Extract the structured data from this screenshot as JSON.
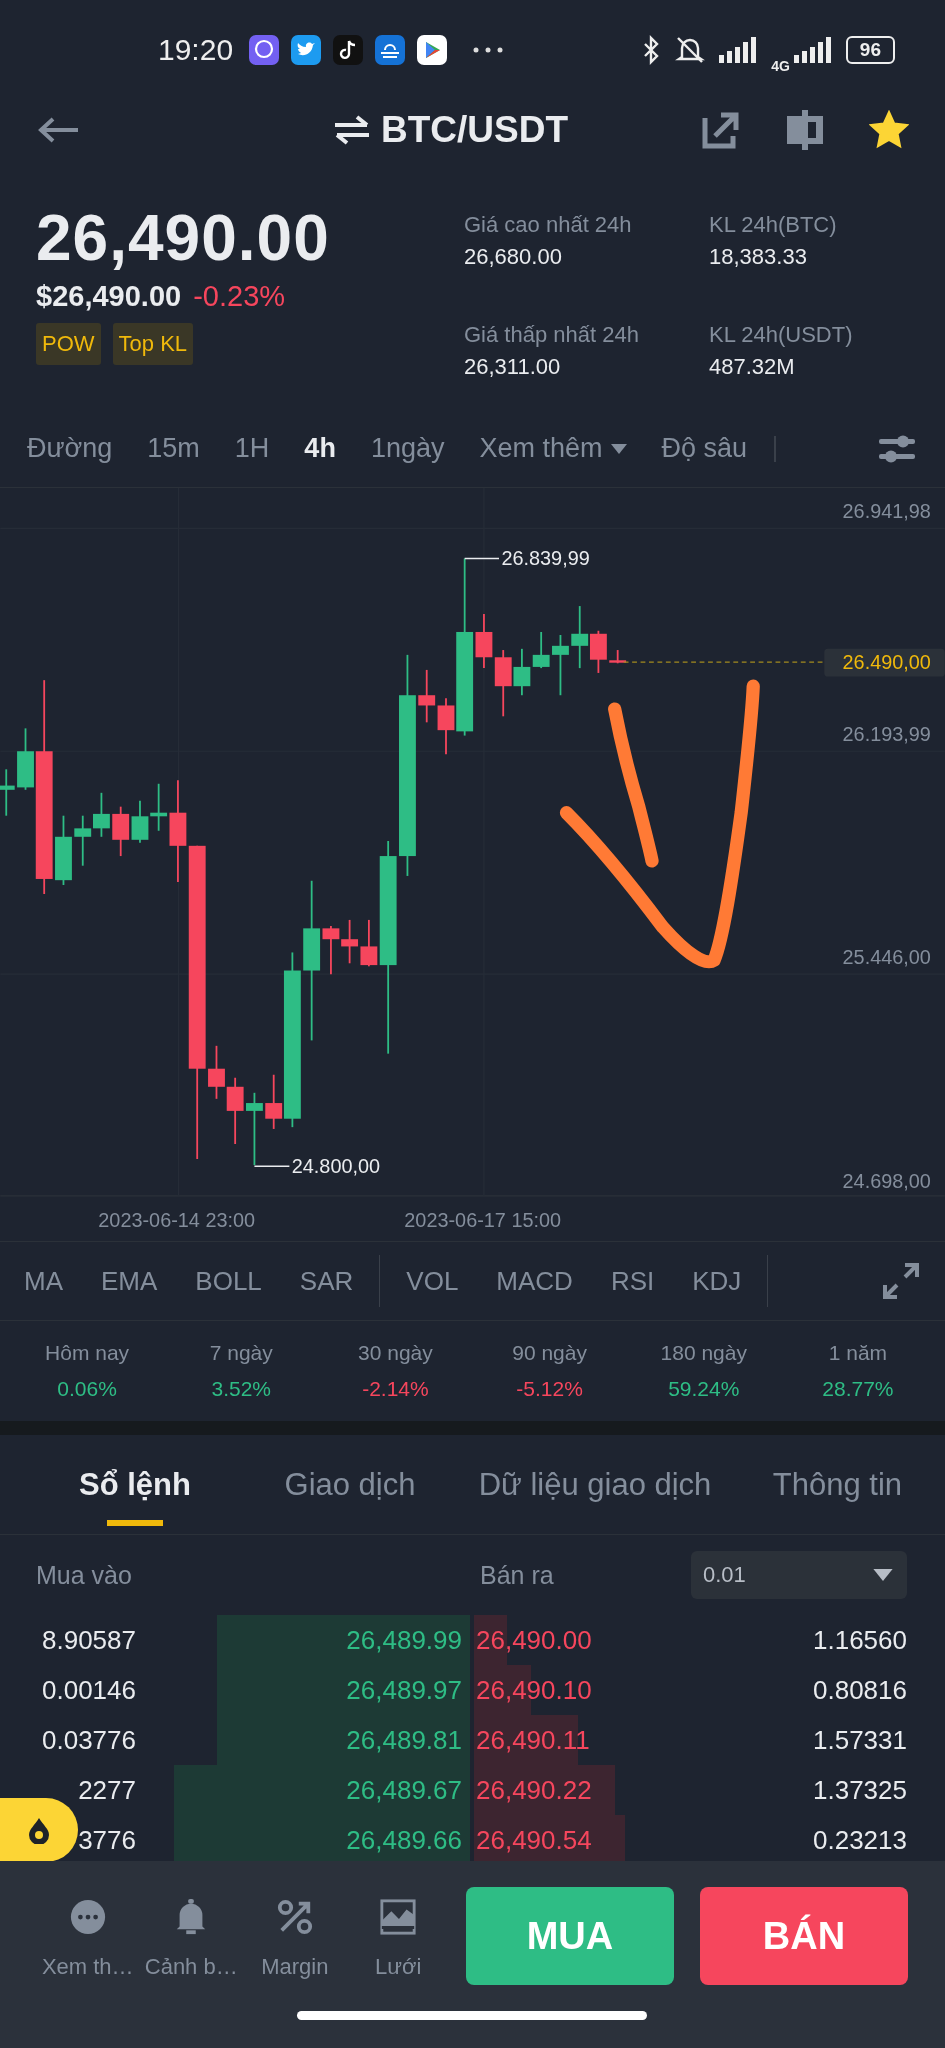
{
  "status_bar": {
    "time": "19:20",
    "network": "4G",
    "battery": "96"
  },
  "header": {
    "title": "BTC/USDT",
    "favorite": true
  },
  "ticker": {
    "price": "26,490.00",
    "price_usd": "$26,490.00",
    "change": "-0.23%",
    "color": "#f6465d",
    "tags": [
      "POW",
      "Top KL"
    ],
    "stats": [
      {
        "label": "Giá cao nhất 24h",
        "value": "26,680.00"
      },
      {
        "label": "KL 24h(BTC)",
        "value": "18,383.33"
      },
      {
        "label": "Giá thấp nhất 24h",
        "value": "26,311.00"
      },
      {
        "label": "KL 24h(USDT)",
        "value": "487.32M"
      }
    ]
  },
  "intervals": [
    {
      "label": "Đường",
      "kind": "tab",
      "selected": false
    },
    {
      "label": "15m",
      "kind": "tab",
      "selected": false
    },
    {
      "label": "1H",
      "kind": "tab",
      "selected": false
    },
    {
      "label": "4h",
      "kind": "tab",
      "selected": true
    },
    {
      "label": "1ngày",
      "kind": "tab",
      "selected": false
    },
    {
      "label": "Xem thêm",
      "kind": "dropdown",
      "selected": false
    },
    {
      "label": "Độ sâu",
      "kind": "tab",
      "selected": false
    }
  ],
  "chart": {
    "y_labels": [
      "26.941,98",
      "26.193,99",
      "25.446,00",
      "24.698,00"
    ],
    "high_label": "26.839,99",
    "low_label": "24.800,00",
    "last_price": "26.490,00",
    "x_labels": [
      "2023-06-14 23:00",
      "2023-06-17 15:00"
    ]
  },
  "indicators": {
    "main": [
      "MA",
      "EMA",
      "BOLL",
      "SAR"
    ],
    "sub": [
      "VOL",
      "MACD",
      "RSI",
      "KDJ"
    ]
  },
  "performance": [
    {
      "period": "Hôm nay",
      "value": "0.06%",
      "color": "#2ebd85"
    },
    {
      "period": "7 ngày",
      "value": "3.52%",
      "color": "#2ebd85"
    },
    {
      "period": "30 ngày",
      "value": "-2.14%",
      "color": "#f6465d"
    },
    {
      "period": "90 ngày",
      "value": "-5.12%",
      "color": "#f6465d"
    },
    {
      "period": "180 ngày",
      "value": "59.24%",
      "color": "#2ebd85"
    },
    {
      "period": "1 năm",
      "value": "28.77%",
      "color": "#2ebd85"
    }
  ],
  "tabs": [
    {
      "label": "Sổ lệnh",
      "selected": true
    },
    {
      "label": "Giao dịch",
      "selected": false
    },
    {
      "label": "Dữ liệu giao dịch",
      "selected": false
    },
    {
      "label": "Thông tin",
      "selected": false
    }
  ],
  "order_book": {
    "bid_label": "Mua vào",
    "ask_label": "Bán ra",
    "precision": "0.01",
    "rows": [
      {
        "bid_qty": "8.90587",
        "bid_price": "26,489.99",
        "ask_price": "26,490.00",
        "ask_qty": "1.16560",
        "bid_depth": {
          "level": 0.65
        },
        "ask_depth": {
          "level": 0.07
        }
      },
      {
        "bid_qty": "0.00146",
        "bid_price": "26,489.97",
        "ask_price": "26,490.10",
        "ask_qty": "0.80816",
        "bid_depth": {
          "level": 0.65
        },
        "ask_depth": {
          "level": 0.12
        }
      },
      {
        "bid_qty": "0.03776",
        "bid_price": "26,489.81",
        "ask_price": "26,490.11",
        "ask_qty": "1.57331",
        "bid_depth": {
          "level": 0.65
        },
        "ask_depth": {
          "level": 0.22
        }
      },
      {
        "bid_qty": "2277",
        "bid_price": "26,489.67",
        "ask_price": "26,490.22",
        "ask_qty": "1.37325",
        "bid_depth": {
          "level": 0.76
        },
        "ask_depth": {
          "level": 0.3
        }
      },
      {
        "bid_qty": "3776",
        "bid_price": "26,489.66",
        "ask_price": "26,490.54",
        "ask_qty": "0.23213",
        "bid_depth": {
          "level": 0.76
        },
        "ask_depth": {
          "level": 0.32
        }
      }
    ]
  },
  "bottom_bar": {
    "actions": [
      {
        "label": "Xem th…",
        "kind": "more"
      },
      {
        "label": "Cảnh b…",
        "kind": "alert"
      },
      {
        "label": "Margin",
        "kind": "margin"
      },
      {
        "label": "Lưới",
        "kind": "grid"
      }
    ],
    "buy": "MUA",
    "sell": "BÁN"
  }
}
